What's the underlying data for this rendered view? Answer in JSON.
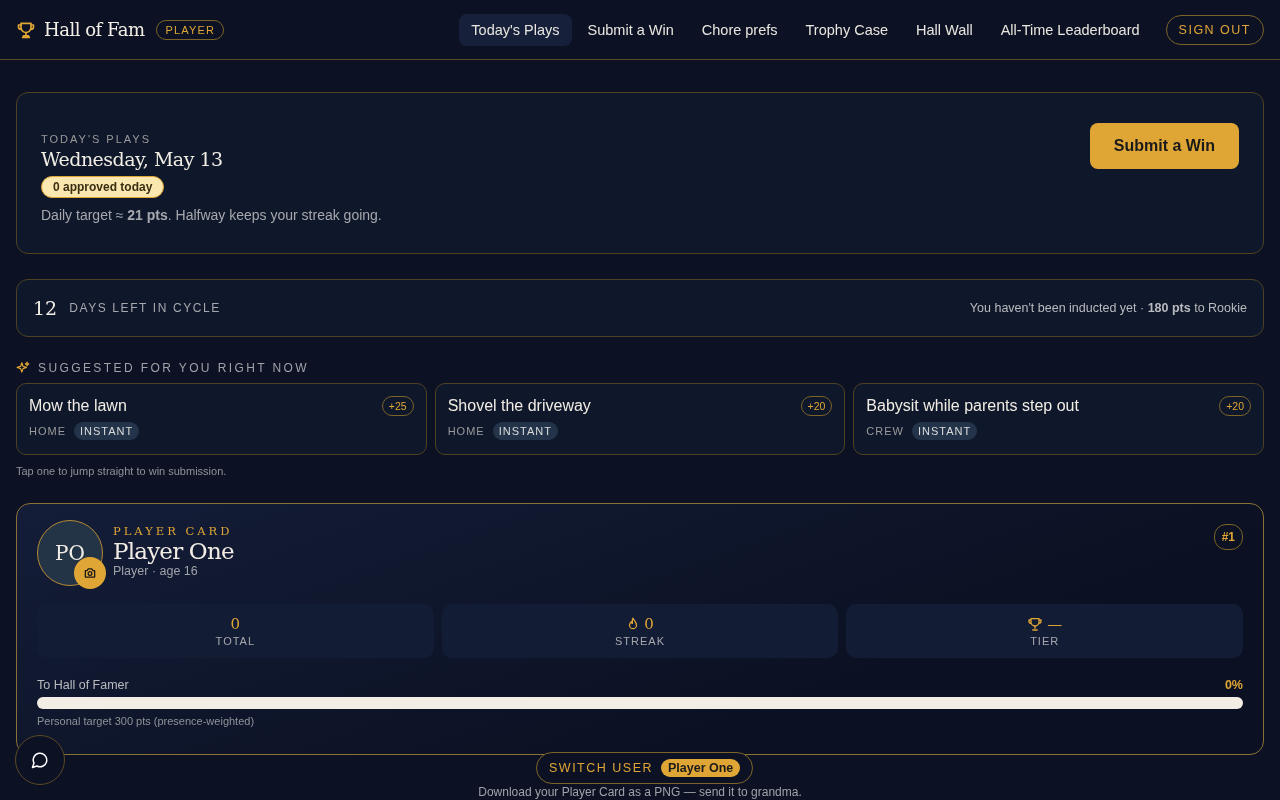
{
  "header": {
    "brand": "Hall of Fam",
    "role_badge": "PLAYER",
    "nav": [
      {
        "label": "Today's Plays",
        "selected": true
      },
      {
        "label": "Submit a Win",
        "selected": false
      },
      {
        "label": "Chore prefs",
        "selected": false
      },
      {
        "label": "Trophy Case",
        "selected": false
      },
      {
        "label": "Hall Wall",
        "selected": false
      },
      {
        "label": "All-Time Leaderboard",
        "selected": false
      }
    ],
    "sign_out": "SIGN OUT"
  },
  "today": {
    "eyebrow": "TODAY'S PLAYS",
    "date": "Wednesday, May 13",
    "approved_badge": "0 approved today",
    "target_text": "Daily target ≈ **21 pts**. Halfway keeps your streak going.",
    "submit_button": "Submit a Win"
  },
  "cycle": {
    "days": "12",
    "label": "DAYS LEFT IN CYCLE",
    "induction_text": "You haven't been inducted yet · **180 pts** to Rookie"
  },
  "suggested": {
    "heading": "SUGGESTED FOR YOU RIGHT NOW",
    "items": [
      {
        "title": "Mow the lawn",
        "points": "+25",
        "category": "HOME",
        "tag": "INSTANT"
      },
      {
        "title": "Shovel the driveway",
        "points": "+20",
        "category": "HOME",
        "tag": "INSTANT"
      },
      {
        "title": "Babysit while parents step out",
        "points": "+20",
        "category": "CREW",
        "tag": "INSTANT"
      }
    ],
    "hint": "Tap one to jump straight to win submission."
  },
  "player_card": {
    "initials": "PO",
    "eyebrow": "PLAYER CARD",
    "name": "Player One",
    "subtitle": "Player · age 16",
    "rank": "#1",
    "stats": [
      {
        "kind": "total",
        "value": "0",
        "label": "TOTAL"
      },
      {
        "kind": "streak",
        "value": "0",
        "label": "STREAK"
      },
      {
        "kind": "tier",
        "value": "—",
        "label": "TIER"
      }
    ],
    "progress": {
      "label": "To Hall of Famer",
      "percent": "0%",
      "level": 0,
      "note": "Personal target 300 pts (presence-weighted)"
    }
  },
  "switch_user": {
    "label": "SWITCH USER",
    "current": "Player One"
  },
  "footer_text": "Download your Player Card as a PNG — send it to grandma."
}
